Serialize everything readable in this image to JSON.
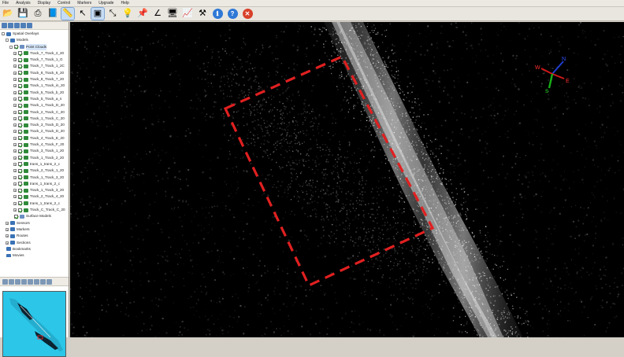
{
  "menu": [
    "File",
    "Analysis",
    "Display",
    "Control",
    "Markers",
    "Upgrade",
    "Help"
  ],
  "toolbar_icons": [
    {
      "name": "open-folder-icon",
      "glyph": "📂",
      "active": false
    },
    {
      "name": "save-icon",
      "glyph": "💾",
      "active": false
    },
    {
      "name": "print-icon",
      "glyph": "⎙",
      "active": false
    },
    {
      "name": "book-icon",
      "glyph": "📘",
      "active": false
    },
    {
      "name": "ruler-icon",
      "glyph": "📏",
      "active": true
    },
    {
      "name": "cursor-icon",
      "glyph": "↖",
      "active": false
    },
    {
      "name": "select-icon",
      "glyph": "▣",
      "active": true
    },
    {
      "name": "measure-icon",
      "glyph": "⤡",
      "active": false
    },
    {
      "name": "lightbulb-icon",
      "glyph": "💡",
      "active": false
    },
    {
      "name": "pin-icon",
      "glyph": "📌",
      "active": false
    },
    {
      "name": "angle-icon",
      "glyph": "∠",
      "active": false
    },
    {
      "name": "monitor-icon",
      "glyph": "🖥",
      "active": false
    },
    {
      "name": "chart-icon",
      "glyph": "📈",
      "active": false
    },
    {
      "name": "tools-icon",
      "glyph": "⚒",
      "active": false
    },
    {
      "name": "info-icon",
      "glyph": "ℹ",
      "active": false
    },
    {
      "name": "help-icon",
      "glyph": "?",
      "active": false
    },
    {
      "name": "close-icon",
      "glyph": "✕",
      "active": false
    }
  ],
  "tree": [
    {
      "depth": 0,
      "label": "Spatial Overlays",
      "exp": "-",
      "cb": false,
      "icon": "#3a72b5"
    },
    {
      "depth": 1,
      "label": "Models",
      "exp": "-",
      "cb": false,
      "icon": "#3a72b5"
    },
    {
      "depth": 2,
      "label": "Point Clouds",
      "exp": "-",
      "cb": true,
      "icon": "#6b8fc4",
      "sel": true
    },
    {
      "depth": 3,
      "label": "Track_7_Track_2_20",
      "exp": "+",
      "cb": true,
      "icon": "#2f8a3a"
    },
    {
      "depth": 3,
      "label": "Track_7_Track_1_G",
      "exp": "+",
      "cb": true,
      "icon": "#2f8a3a"
    },
    {
      "depth": 3,
      "label": "Track_7_Track_1_2C",
      "exp": "+",
      "cb": true,
      "icon": "#2f8a3a"
    },
    {
      "depth": 3,
      "label": "Track_8_Track_6_20",
      "exp": "+",
      "cb": true,
      "icon": "#2f8a3a"
    },
    {
      "depth": 3,
      "label": "Track_8_Track_7_20",
      "exp": "+",
      "cb": true,
      "icon": "#2f8a3a"
    },
    {
      "depth": 3,
      "label": "Track_1_Track_in_20",
      "exp": "+",
      "cb": true,
      "icon": "#2f8a3a"
    },
    {
      "depth": 3,
      "label": "Track_5_Track_b_20",
      "exp": "+",
      "cb": true,
      "icon": "#2f8a3a"
    },
    {
      "depth": 3,
      "label": "Track_5_Track_a_s",
      "exp": "+",
      "cb": true,
      "icon": "#2f8a3a"
    },
    {
      "depth": 3,
      "label": "Track_1_Track_D_20",
      "exp": "+",
      "cb": true,
      "icon": "#2f8a3a"
    },
    {
      "depth": 3,
      "label": "Track_2_Track_C_20",
      "exp": "+",
      "cb": true,
      "icon": "#2f8a3a"
    },
    {
      "depth": 3,
      "label": "Track_1_Track_C_20",
      "exp": "+",
      "cb": true,
      "icon": "#2f8a3a"
    },
    {
      "depth": 3,
      "label": "Track_3_Track_D_20",
      "exp": "+",
      "cb": true,
      "icon": "#2f8a3a"
    },
    {
      "depth": 3,
      "label": "Track_2_Track_D_20",
      "exp": "+",
      "cb": true,
      "icon": "#2f8a3a"
    },
    {
      "depth": 3,
      "label": "Track_4_Track_E_20",
      "exp": "+",
      "cb": true,
      "icon": "#2f8a3a"
    },
    {
      "depth": 3,
      "label": "Track_4_Track_F_20",
      "exp": "+",
      "cb": true,
      "icon": "#2f8a3a"
    },
    {
      "depth": 3,
      "label": "Track_3_Track_1_20",
      "exp": "+",
      "cb": true,
      "icon": "#2f8a3a"
    },
    {
      "depth": 3,
      "label": "Track_1_Track_2_20",
      "exp": "+",
      "cb": true,
      "icon": "#2f8a3a"
    },
    {
      "depth": 3,
      "label": "trans_1_trans_2_c",
      "exp": "+",
      "cb": true,
      "icon": "#2f8a3a"
    },
    {
      "depth": 3,
      "label": "Track_2_Track_1_20",
      "exp": "+",
      "cb": true,
      "icon": "#2f8a3a"
    },
    {
      "depth": 3,
      "label": "Track_1_Track_3_20",
      "exp": "+",
      "cb": true,
      "icon": "#2f8a3a"
    },
    {
      "depth": 3,
      "label": "trans_1_trans_2_c",
      "exp": "+",
      "cb": true,
      "icon": "#2f8a3a"
    },
    {
      "depth": 3,
      "label": "Track_1_Track_3_20",
      "exp": "+",
      "cb": true,
      "icon": "#2f8a3a"
    },
    {
      "depth": 3,
      "label": "Track_2_Track_4_20",
      "exp": "+",
      "cb": true,
      "icon": "#2f8a3a"
    },
    {
      "depth": 3,
      "label": "trans_1_trans_2_c",
      "exp": "+",
      "cb": true,
      "icon": "#2f8a3a"
    },
    {
      "depth": 3,
      "label": "Track_C_Track_C_20",
      "exp": "+",
      "cb": true,
      "icon": "#2f8a3a"
    },
    {
      "depth": 2,
      "label": "Surface Models",
      "exp": "",
      "cb": true,
      "icon": "#6b8fc4"
    },
    {
      "depth": 1,
      "label": "Sensors",
      "exp": "+",
      "cb": false,
      "icon": "#3a72b5"
    },
    {
      "depth": 1,
      "label": "Markers",
      "exp": "+",
      "cb": false,
      "icon": "#3a72b5"
    },
    {
      "depth": 1,
      "label": "Routes",
      "exp": "+",
      "cb": false,
      "icon": "#3a72b5"
    },
    {
      "depth": 1,
      "label": "Sections",
      "exp": "+",
      "cb": false,
      "icon": "#3a72b5"
    },
    {
      "depth": 0,
      "label": "Bookmarks",
      "exp": "",
      "cb": false,
      "icon": "#3a72b5"
    },
    {
      "depth": 0,
      "label": "Movies",
      "exp": "",
      "cb": false,
      "icon": "#3a72b5"
    }
  ],
  "compass": {
    "labels": [
      "N",
      "W",
      "E",
      "S"
    ]
  },
  "colors": {
    "selection_box": "#e02020",
    "minimap_bg": "#28c4e6",
    "viewport_bg": "#000000"
  }
}
